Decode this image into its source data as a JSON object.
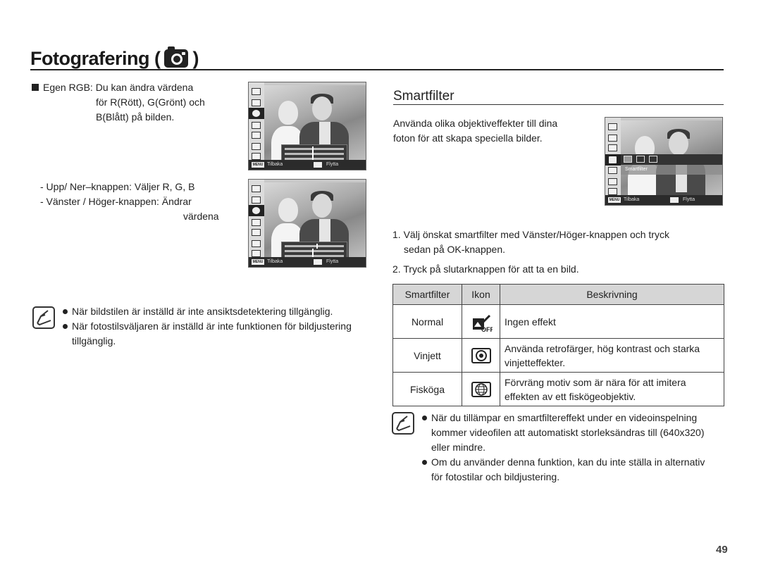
{
  "header": {
    "title_prefix": "Fotografering (",
    "title_suffix": ")",
    "icon": "camera-icon"
  },
  "left": {
    "egen_rgb": {
      "label": "Egen RGB:",
      "lines": [
        "Du kan ändra värdena",
        "för R(Rött), G(Grönt) och",
        "B(Blått) på bilden."
      ]
    },
    "instructions": [
      "- Upp/ Ner–knappen: Väljer R, G, B",
      "- Vänster / Höger-knappen: Ändrar",
      "värdena"
    ],
    "notes": [
      "När bildstilen är inställd är inte ansiktsdetektering tillgänglig.",
      "När fotostilsväljaren är inställd är inte funktionen för bildjustering tillgänglig."
    ]
  },
  "screens": {
    "menu_key": "MENU",
    "back_label": "Tilbaka",
    "move_label": "Flytta",
    "rgb_rows": [
      "R",
      "G",
      "B"
    ],
    "smartfilter_label": "Smartfilter"
  },
  "right": {
    "section_title": "Smartfilter",
    "intro": [
      "Använda olika objektiveffekter till dina",
      "foton för att skapa speciella bilder."
    ],
    "steps": [
      {
        "num": "1.",
        "text": "Välj önskat smartfilter med Vänster/Höger-knappen och tryck",
        "cont": "sedan på OK-knappen."
      },
      {
        "num": "2.",
        "text": "Tryck på slutarknappen för att ta en bild."
      }
    ],
    "table": {
      "headers": [
        "Smartfilter",
        "Ikon",
        "Beskrivning"
      ],
      "rows": [
        {
          "name": "Normal",
          "icon": "normal-off-icon",
          "desc": [
            "Ingen effekt"
          ]
        },
        {
          "name": "Vinjett",
          "icon": "vignette-icon",
          "desc": [
            "Använda retrofärger, hög kontrast och starka",
            "vinjetteffekter."
          ]
        },
        {
          "name": "Fisköga",
          "icon": "fisheye-icon",
          "desc": [
            "Förvräng motiv som är nära för att imitera",
            "effekten av ett fiskögeobjektiv."
          ]
        }
      ]
    },
    "notes": [
      [
        "När du tillämpar en smartfiltereffekt under en videoinspelning",
        "kommer videofilen att automatiskt storleksändras till (640x320)",
        "eller mindre."
      ],
      [
        "Om du använder denna funktion, kan du inte ställa in alternativ",
        "för fotostilar och bildjustering."
      ]
    ]
  },
  "footer": {
    "page_number": "49"
  }
}
